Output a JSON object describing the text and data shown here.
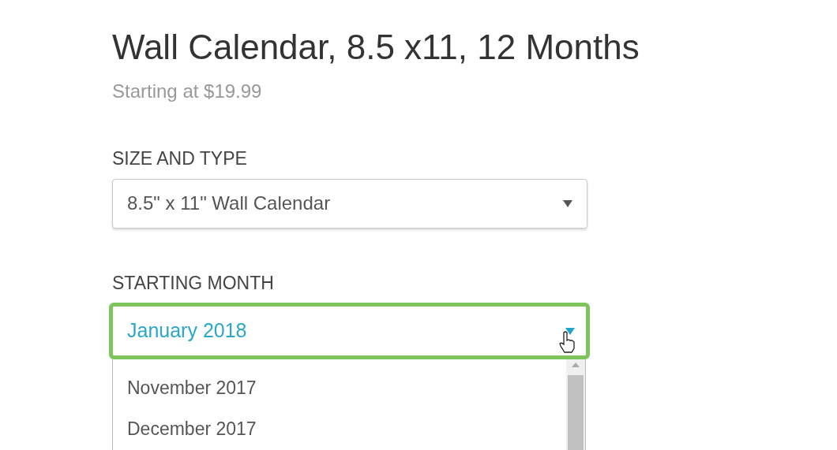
{
  "product": {
    "title": "Wall Calendar, 8.5 x11, 12 Months",
    "price": "Starting at $19.99"
  },
  "fields": [
    {
      "label": "SIZE AND TYPE",
      "value": "8.5\" x 11\" Wall Calendar",
      "expanded": false
    },
    {
      "label": "STARTING MONTH",
      "value": "January 2018",
      "expanded": true,
      "options": [
        {
          "label": "November 2017",
          "selected": false
        },
        {
          "label": "December 2017",
          "selected": false
        }
      ]
    }
  ]
}
